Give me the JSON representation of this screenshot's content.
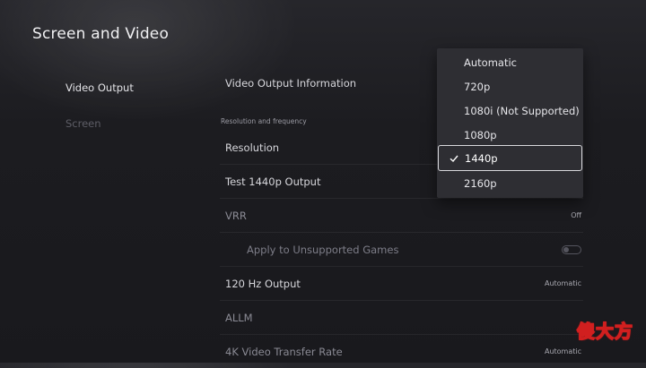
{
  "page": {
    "title": "Screen and Video"
  },
  "sidebar": {
    "items": [
      {
        "label": "Video Output"
      },
      {
        "label": "Screen"
      }
    ]
  },
  "main": {
    "video_output_info": "Video Output Information",
    "section_header": "Resolution and frequency",
    "rows": [
      {
        "label": "Resolution",
        "value": ""
      },
      {
        "label": "Test 1440p Output",
        "value": ""
      },
      {
        "label": "VRR",
        "value": "Off"
      },
      {
        "label": "Apply to Unsupported Games",
        "value": ""
      },
      {
        "label": "120 Hz Output",
        "value": "Automatic"
      },
      {
        "label": "ALLM",
        "value": ""
      },
      {
        "label": "4K Video Transfer Rate",
        "value": "Automatic"
      }
    ]
  },
  "resolution_dropdown": {
    "options": [
      "Automatic",
      "720p",
      "1080i (Not Supported)",
      "1080p",
      "1440p",
      "2160p"
    ],
    "selected": "1440p"
  },
  "icons": {
    "check": "checkmark-icon",
    "toggle": "toggle-switch"
  },
  "watermark": {
    "text": "傻大方",
    "colors": {
      "fill": "#ffffff",
      "stroke": "#d11f1f"
    }
  }
}
